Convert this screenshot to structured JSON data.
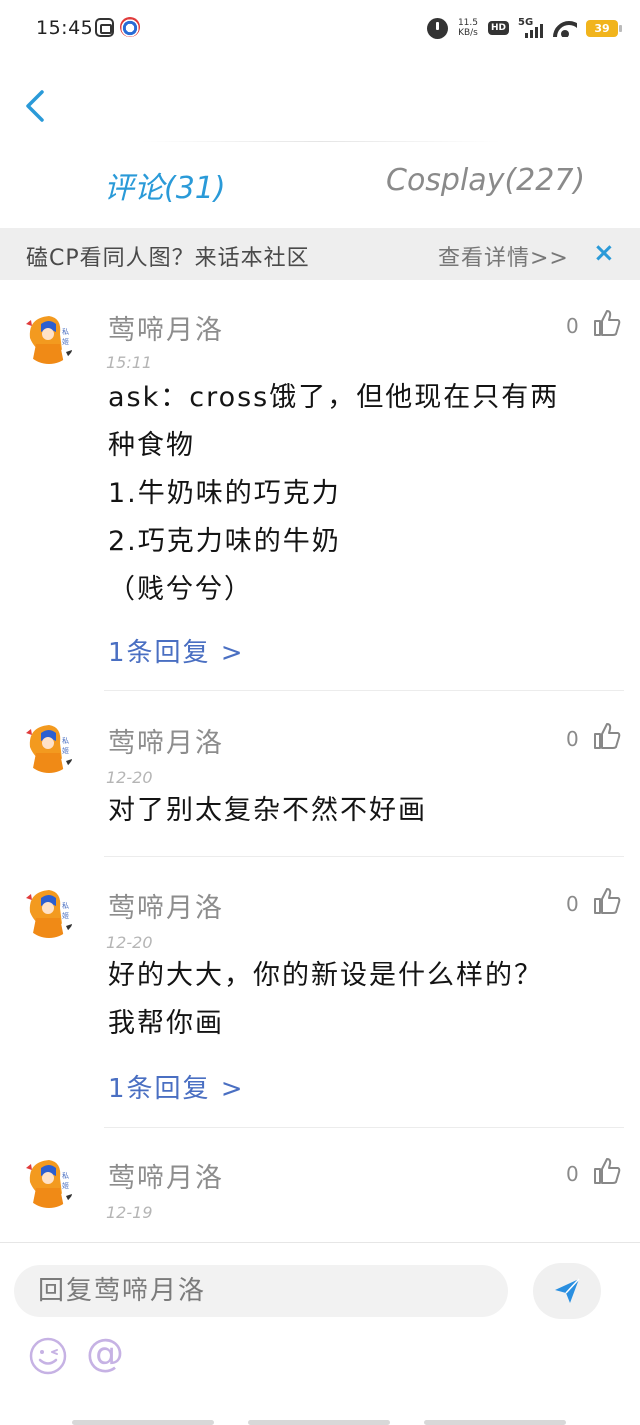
{
  "status_bar": {
    "time": "15:45",
    "net_speed_top": "11.5",
    "net_speed_bottom": "KB/s",
    "hd": "HD",
    "network": "5G",
    "battery": "39",
    "icons": [
      "app-icon",
      "app-icon-2",
      "alarm-icon",
      "signal-icon",
      "wifi-icon",
      "battery-icon"
    ]
  },
  "nav": {
    "back_icon": "chevron-left-icon"
  },
  "tabs": [
    {
      "label": "评论(31)",
      "active": true,
      "color": "#2a9ad8"
    },
    {
      "label": "Cosplay(227)",
      "active": false,
      "color": "#8a8a8a"
    }
  ],
  "banner": {
    "text": "磕CP看同人图？来话本社区",
    "link": "查看详情>>",
    "close": "×"
  },
  "comments": [
    {
      "name": "莺啼月洛",
      "time": "15:11",
      "likes": "0",
      "lines": [
        "ask：cross饿了，但他现在只有两",
        "种食物",
        "1.牛奶味的巧克力",
        "2.巧克力味的牛奶",
        "（贱兮兮）"
      ],
      "reply": "1条回复 >"
    },
    {
      "name": "莺啼月洛",
      "time": "12-20",
      "likes": "0",
      "lines": [
        "对了别太复杂不然不好画"
      ],
      "reply": ""
    },
    {
      "name": "莺啼月洛",
      "time": "12-20",
      "likes": "0",
      "lines": [
        "好的大大，你的新设是什么样的？",
        "我帮你画"
      ],
      "reply": "1条回复 >"
    },
    {
      "name": "莺啼月洛",
      "time": "12-19",
      "likes": "0",
      "lines": [],
      "reply": ""
    }
  ],
  "composer": {
    "placeholder": "回复莺啼月洛",
    "send_icon": "send-icon",
    "emoji_icon": "emoji-icon",
    "at_label": "@"
  },
  "colors": {
    "accent": "#2a9ad8",
    "reply_link": "#4a6fc2",
    "banner_bg": "#eeeeee"
  }
}
